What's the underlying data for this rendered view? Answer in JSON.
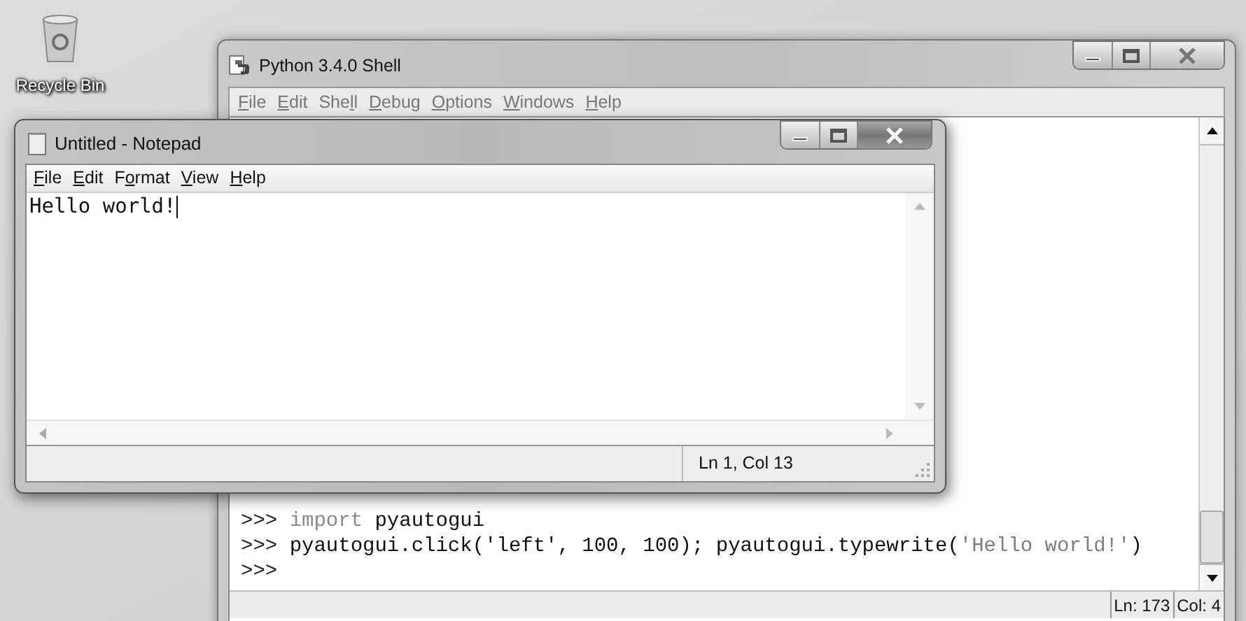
{
  "desktop": {
    "icons": [
      {
        "label": "Recycle Bin"
      }
    ]
  },
  "shell_window": {
    "title": "Python 3.4.0 Shell",
    "menu": [
      {
        "key": "F",
        "post": "ile"
      },
      {
        "key": "E",
        "post": "dit"
      },
      {
        "pre": "She",
        "key": "l",
        "post": "l"
      },
      {
        "key": "D",
        "post": "ebug"
      },
      {
        "key": "O",
        "post": "ptions"
      },
      {
        "key": "W",
        "post": "indows"
      },
      {
        "key": "H",
        "post": "elp"
      }
    ],
    "lines": [
      {
        "segments": [
          {
            "kind": "prompt",
            "text": ">>> "
          },
          {
            "kind": "keyword",
            "text": "import"
          },
          {
            "kind": "plain",
            "text": " pyautogui"
          }
        ]
      },
      {
        "segments": [
          {
            "kind": "prompt",
            "text": ">>> "
          },
          {
            "kind": "plain",
            "text": "pyautogui.click('left', 100, 100); pyautogui.typewrite("
          },
          {
            "kind": "string",
            "text": "'Hello world!'"
          },
          {
            "kind": "plain",
            "text": ")"
          }
        ]
      },
      {
        "segments": [
          {
            "kind": "prompt",
            "text": ">>>"
          }
        ]
      }
    ],
    "status": [
      "Ln: 173",
      "Col: 4"
    ]
  },
  "notepad_window": {
    "title": "Untitled - Notepad",
    "menu": [
      {
        "key": "F",
        "post": "ile"
      },
      {
        "key": "E",
        "post": "dit"
      },
      {
        "pre": "F",
        "key": "o",
        "post": "rmat"
      },
      {
        "key": "V",
        "post": "iew"
      },
      {
        "key": "H",
        "post": "elp"
      }
    ],
    "text": "Hello world!",
    "status": "Ln 1, Col 13"
  }
}
